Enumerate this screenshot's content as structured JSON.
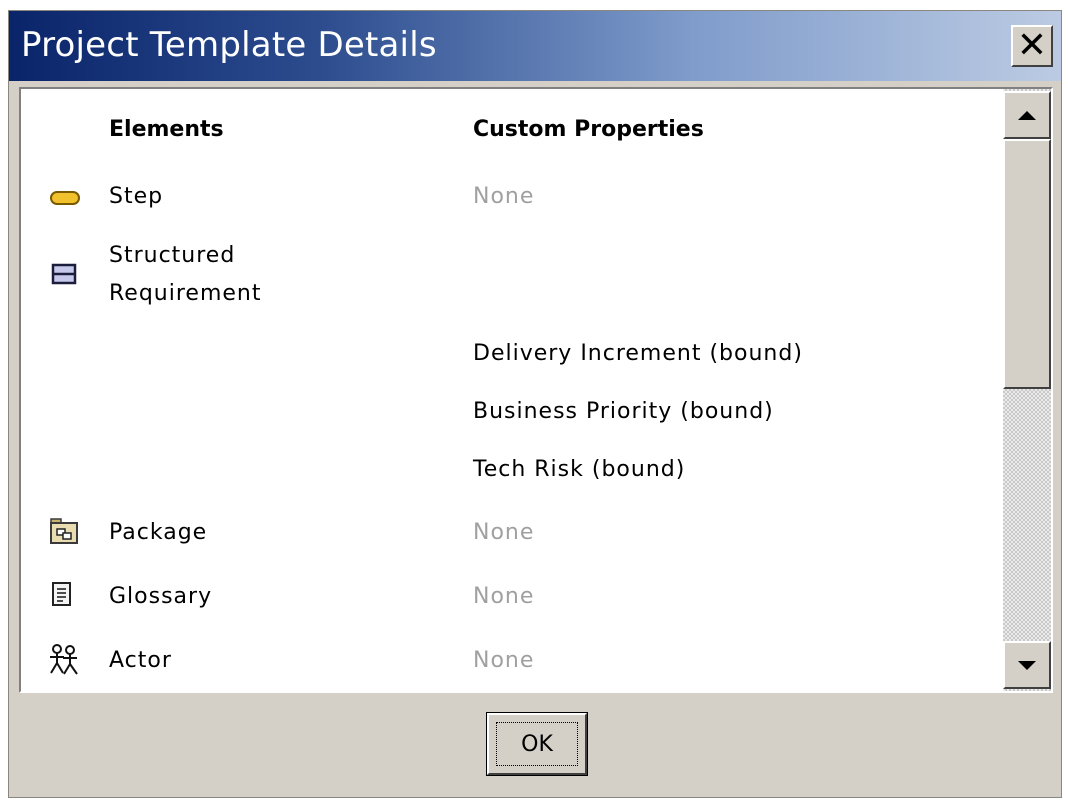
{
  "window": {
    "title": "Project Template Details",
    "close_label": "✕"
  },
  "table": {
    "headers": {
      "elements": "Elements",
      "custom_properties": "Custom Properties"
    },
    "rows": [
      {
        "element": "Step",
        "icon": "step-icon",
        "property": "None"
      },
      {
        "element": "Structured",
        "element_line2": "Requirement",
        "icon": "structured-requirement-icon",
        "property": ""
      },
      {
        "element": "",
        "property": "Delivery Increment (bound)"
      },
      {
        "element": "",
        "property": "Business Priority (bound)"
      },
      {
        "element": "",
        "property": "Tech Risk (bound)"
      },
      {
        "element": "Package",
        "icon": "package-icon",
        "property": "None"
      },
      {
        "element": "Glossary",
        "icon": "glossary-icon",
        "property": "None"
      },
      {
        "element": "Actor",
        "icon": "actor-icon",
        "property": "None"
      }
    ]
  },
  "buttons": {
    "ok": "OK"
  },
  "colors": {
    "titlebar_start": "#0a246a",
    "titlebar_end": "#bccbe3",
    "dialog_face": "#d4d0c8",
    "none_text": "#a0a0a0",
    "step_fill": "#f2c12e",
    "requirement_fill": "#c6c9ec"
  }
}
